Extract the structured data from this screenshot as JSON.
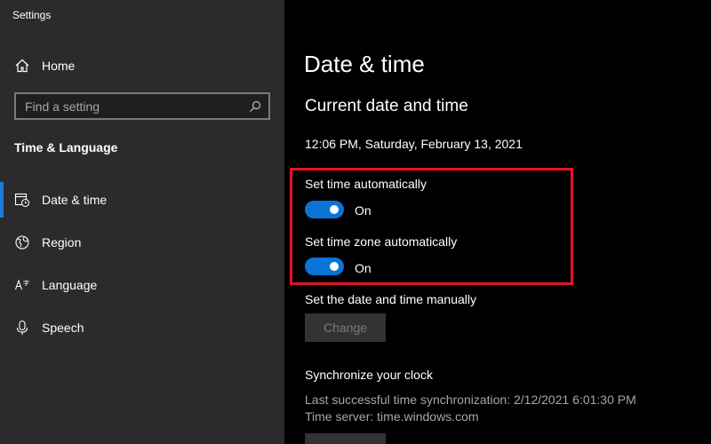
{
  "window": {
    "title": "Settings"
  },
  "sidebar": {
    "home_label": "Home",
    "search_placeholder": "Find a setting",
    "section_title": "Time & Language",
    "items": [
      {
        "label": "Date & time",
        "icon": "date-time-icon",
        "active": true
      },
      {
        "label": "Region",
        "icon": "globe-icon",
        "active": false
      },
      {
        "label": "Language",
        "icon": "language-icon",
        "active": false
      },
      {
        "label": "Speech",
        "icon": "microphone-icon",
        "active": false
      }
    ]
  },
  "main": {
    "title": "Date & time",
    "subtitle": "Current date and time",
    "current_time": "12:06 PM, Saturday, February 13, 2021",
    "set_time_auto": {
      "label": "Set time automatically",
      "state": "On"
    },
    "set_timezone_auto": {
      "label": "Set time zone automatically",
      "state": "On"
    },
    "manual": {
      "label": "Set the date and time manually",
      "button": "Change"
    },
    "sync": {
      "title": "Synchronize your clock",
      "last_sync": "Last successful time synchronization: 2/12/2021 6:01:30 PM",
      "server": "Time server: time.windows.com"
    }
  },
  "colors": {
    "accent": "#0a74d6",
    "highlight_border": "#e81123",
    "sidebar_bg": "#2b2b2b",
    "main_bg": "#000000"
  }
}
